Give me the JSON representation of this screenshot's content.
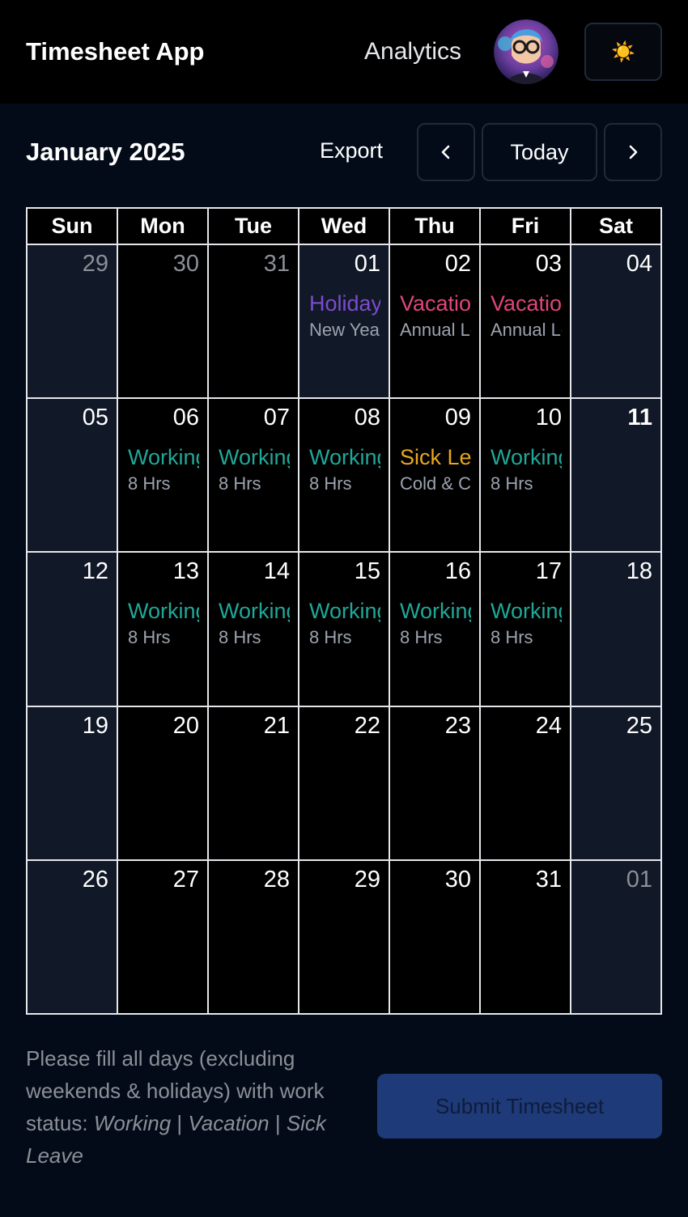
{
  "header": {
    "app_title": "Timesheet App",
    "nav_analytics": "Analytics",
    "theme_icon": "☀️"
  },
  "toolbar": {
    "month_title": "January 2025",
    "export_label": "Export",
    "prev_icon": "‹",
    "today_label": "Today",
    "next_icon": "›"
  },
  "calendar": {
    "weekdays": [
      "Sun",
      "Mon",
      "Tue",
      "Wed",
      "Thu",
      "Fri",
      "Sat"
    ],
    "cells": [
      {
        "day": "29",
        "muted": true,
        "shaded": true
      },
      {
        "day": "30",
        "muted": true
      },
      {
        "day": "31",
        "muted": true
      },
      {
        "day": "01",
        "shaded": true,
        "event": {
          "title": "Holiday",
          "sub": "New Year",
          "color": "#7c4dcc"
        }
      },
      {
        "day": "02",
        "event": {
          "title": "Vacation",
          "sub": "Annual Leave",
          "color": "#e0457b"
        }
      },
      {
        "day": "03",
        "event": {
          "title": "Vacation",
          "sub": "Annual Leave",
          "color": "#e0457b"
        }
      },
      {
        "day": "04",
        "shaded": true
      },
      {
        "day": "05",
        "shaded": true
      },
      {
        "day": "06",
        "event": {
          "title": "Working",
          "sub": "8 Hrs",
          "color": "#1fa898"
        }
      },
      {
        "day": "07",
        "event": {
          "title": "Working",
          "sub": "8 Hrs",
          "color": "#1fa898"
        }
      },
      {
        "day": "08",
        "event": {
          "title": "Working",
          "sub": "8 Hrs",
          "color": "#1fa898"
        }
      },
      {
        "day": "09",
        "event": {
          "title": "Sick Leave",
          "sub": "Cold & Cough",
          "color": "#e8a71e"
        }
      },
      {
        "day": "10",
        "event": {
          "title": "Working",
          "sub": "8 Hrs",
          "color": "#1fa898"
        }
      },
      {
        "day": "11",
        "shaded": true,
        "today": true
      },
      {
        "day": "12",
        "shaded": true
      },
      {
        "day": "13",
        "event": {
          "title": "Working",
          "sub": "8 Hrs",
          "color": "#1fa898"
        }
      },
      {
        "day": "14",
        "event": {
          "title": "Working",
          "sub": "8 Hrs",
          "color": "#1fa898"
        }
      },
      {
        "day": "15",
        "event": {
          "title": "Working",
          "sub": "8 Hrs",
          "color": "#1fa898"
        }
      },
      {
        "day": "16",
        "event": {
          "title": "Working",
          "sub": "8 Hrs",
          "color": "#1fa898"
        }
      },
      {
        "day": "17",
        "event": {
          "title": "Working",
          "sub": "8 Hrs",
          "color": "#1fa898"
        }
      },
      {
        "day": "18",
        "shaded": true
      },
      {
        "day": "19",
        "shaded": true
      },
      {
        "day": "20"
      },
      {
        "day": "21"
      },
      {
        "day": "22"
      },
      {
        "day": "23"
      },
      {
        "day": "24"
      },
      {
        "day": "25",
        "shaded": true
      },
      {
        "day": "26",
        "shaded": true
      },
      {
        "day": "27"
      },
      {
        "day": "28"
      },
      {
        "day": "29"
      },
      {
        "day": "30"
      },
      {
        "day": "31"
      },
      {
        "day": "01",
        "muted": true,
        "shaded": true
      }
    ]
  },
  "footer": {
    "note_prefix": "Please fill all days (excluding weekends & holidays) with work status: ",
    "status_working": "Working",
    "sep1": " | ",
    "status_vacation": "Vacation",
    "sep2": " | ",
    "status_sick": "Sick Leave",
    "submit_label": "Submit Timesheet"
  }
}
